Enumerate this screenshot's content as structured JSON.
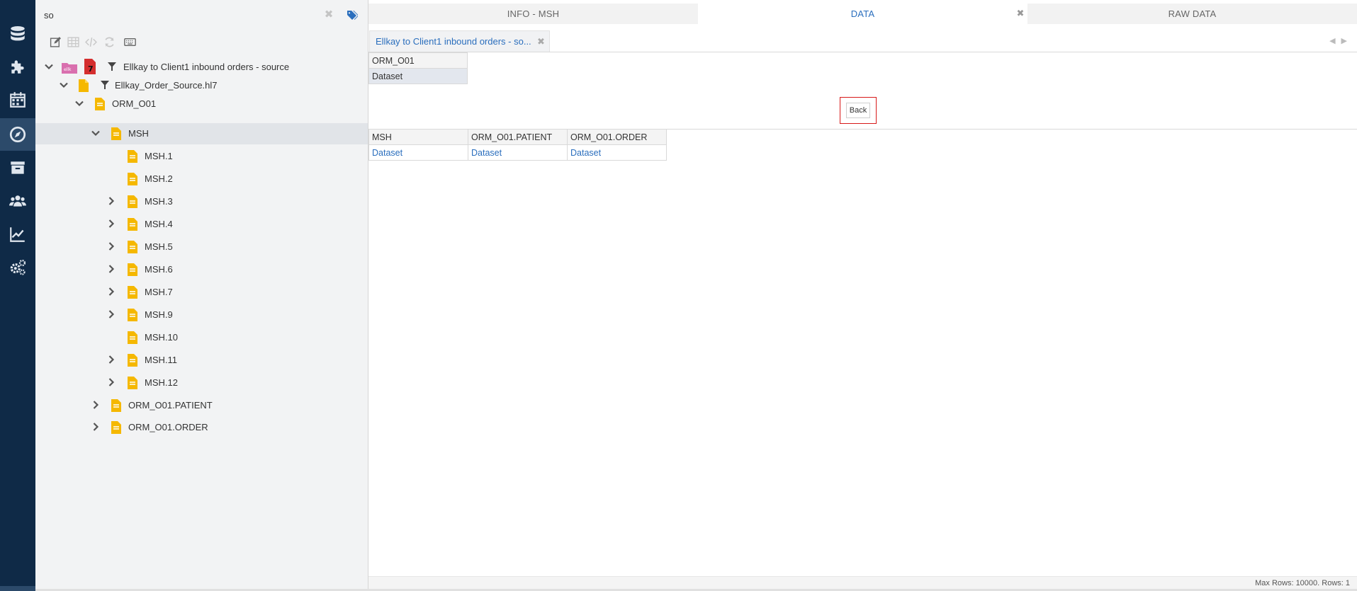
{
  "rail": {
    "items": [
      {
        "icon": "database-icon"
      },
      {
        "icon": "puzzle-icon"
      },
      {
        "icon": "calendar-icon"
      },
      {
        "icon": "compass-icon",
        "active": true
      },
      {
        "icon": "archive-icon"
      },
      {
        "icon": "users-icon"
      },
      {
        "icon": "chart-line-icon"
      },
      {
        "icon": "gears-icon"
      }
    ]
  },
  "tree": {
    "search_value": "so",
    "toolbar": [
      "edit-icon",
      "table-icon",
      "code-icon",
      "refresh-icon",
      "keyboard-icon"
    ],
    "root": {
      "label": "Ellkay to Client1 inbound orders - source"
    },
    "file": {
      "label": "Ellkay_Order_Source.hl7"
    },
    "message": {
      "label": "ORM_O01"
    },
    "segment": {
      "label": "MSH"
    },
    "fields": [
      {
        "label": "MSH.1",
        "expandable": false
      },
      {
        "label": "MSH.2",
        "expandable": false
      },
      {
        "label": "MSH.3",
        "expandable": true
      },
      {
        "label": "MSH.4",
        "expandable": true
      },
      {
        "label": "MSH.5",
        "expandable": true
      },
      {
        "label": "MSH.6",
        "expandable": true
      },
      {
        "label": "MSH.7",
        "expandable": true
      },
      {
        "label": "MSH.9",
        "expandable": true
      },
      {
        "label": "MSH.10",
        "expandable": false
      },
      {
        "label": "MSH.11",
        "expandable": true
      },
      {
        "label": "MSH.12",
        "expandable": true
      }
    ],
    "groups": [
      {
        "label": "ORM_O01.PATIENT"
      },
      {
        "label": "ORM_O01.ORDER"
      }
    ]
  },
  "tabs": [
    {
      "label": "INFO - MSH",
      "active": false
    },
    {
      "label": "DATA",
      "active": true
    },
    {
      "label": "RAW DATA",
      "active": false
    }
  ],
  "subtab": {
    "label": "Ellkay to Client1 inbound orders - so..."
  },
  "top_grid": {
    "header": "ORM_O01",
    "cell": "Dataset"
  },
  "back_label": "Back",
  "bottom_grid": {
    "headers": [
      "MSH",
      "ORM_O01.PATIENT",
      "ORM_O01.ORDER"
    ],
    "cells": [
      "Dataset",
      "Dataset",
      "Dataset"
    ]
  },
  "status": "Max Rows: 10000. Rows: 1",
  "colors": {
    "rail": "#0f2a47",
    "accent": "#2a6ebd",
    "highlight": "#d71a1a"
  }
}
